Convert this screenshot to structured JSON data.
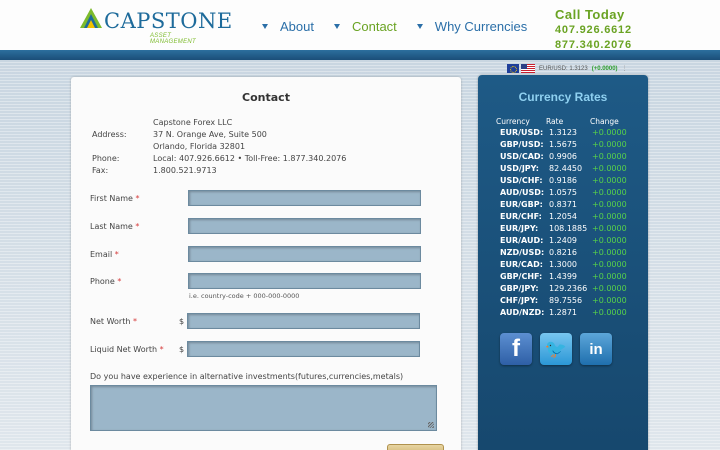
{
  "brand": {
    "name": "CAPSTONE",
    "tagline": "ASSET MANAGEMENT",
    "colors": {
      "blue": "#1e6b9b",
      "green": "#7dbb2c"
    }
  },
  "nav": {
    "items": [
      {
        "label": "About",
        "active": false
      },
      {
        "label": "Contact",
        "active": true
      },
      {
        "label": "Why Currencies",
        "active": false
      }
    ]
  },
  "call": {
    "title": "Call Today",
    "phones": [
      "407.926.6612",
      "877.340.2076"
    ]
  },
  "ticker": {
    "text": "EUR/USD: 1.3123",
    "change": "(+0.0000)",
    "icons": [
      "eu-flag-icon",
      "us-flag-icon"
    ]
  },
  "contact": {
    "title": "Contact",
    "company": "Capstone Forex LLC",
    "address_label": "Address:",
    "address_line1": "37 N. Orange Ave, Suite 500",
    "address_line2": "Orlando, Florida 32801",
    "phone_label": "Phone:",
    "phone_value": "Local: 407.926.6612 • Toll-Free: 1.877.340.2076",
    "fax_label": "Fax:",
    "fax_value": "1.800.521.9713"
  },
  "form": {
    "first_name": "First Name",
    "last_name": "Last Name",
    "email": "Email",
    "phone": "Phone",
    "phone_hint": "i.e. country-code + 000-000-0000",
    "net_worth": "Net Worth",
    "liquid_net_worth": "Liquid Net Worth",
    "required_mark": "*",
    "currency_symbol": "$",
    "experience_question": "Do you have experience in alternative investments(futures,currencies,metals)"
  },
  "rates": {
    "title": "Currency Rates",
    "headers": [
      "Currency",
      "Rate",
      "Change"
    ],
    "rows": [
      {
        "pair": "EUR/USD:",
        "rate": "1.3123",
        "change": "+0.0000"
      },
      {
        "pair": "GBP/USD:",
        "rate": "1.5675",
        "change": "+0.0000"
      },
      {
        "pair": "USD/CAD:",
        "rate": "0.9906",
        "change": "+0.0000"
      },
      {
        "pair": "USD/JPY:",
        "rate": "82.4450",
        "change": "+0.0000"
      },
      {
        "pair": "USD/CHF:",
        "rate": "0.9186",
        "change": "+0.0000"
      },
      {
        "pair": "AUD/USD:",
        "rate": "1.0575",
        "change": "+0.0000"
      },
      {
        "pair": "EUR/GBP:",
        "rate": "0.8371",
        "change": "+0.0000"
      },
      {
        "pair": "EUR/CHF:",
        "rate": "1.2054",
        "change": "+0.0000"
      },
      {
        "pair": "EUR/JPY:",
        "rate": "108.1885",
        "change": "+0.0000"
      },
      {
        "pair": "EUR/AUD:",
        "rate": "1.2409",
        "change": "+0.0000"
      },
      {
        "pair": "NZD/USD:",
        "rate": "0.8216",
        "change": "+0.0000"
      },
      {
        "pair": "EUR/CAD:",
        "rate": "1.3000",
        "change": "+0.0000"
      },
      {
        "pair": "GBP/CHF:",
        "rate": "1.4399",
        "change": "+0.0000"
      },
      {
        "pair": "GBP/JPY:",
        "rate": "129.2366",
        "change": "+0.0000"
      },
      {
        "pair": "CHF/JPY:",
        "rate": "89.7556",
        "change": "+0.0000"
      },
      {
        "pair": "AUD/NZD:",
        "rate": "1.2871",
        "change": "+0.0000"
      }
    ],
    "colors": {
      "change": "#57d24a",
      "title": "#8fd0f0"
    }
  },
  "social": {
    "facebook": {
      "glyph": "f",
      "icon": "facebook-icon"
    },
    "twitter": {
      "glyph": "🐦",
      "icon": "twitter-icon"
    },
    "linkedin": {
      "glyph": "in",
      "icon": "linkedin-icon"
    }
  }
}
